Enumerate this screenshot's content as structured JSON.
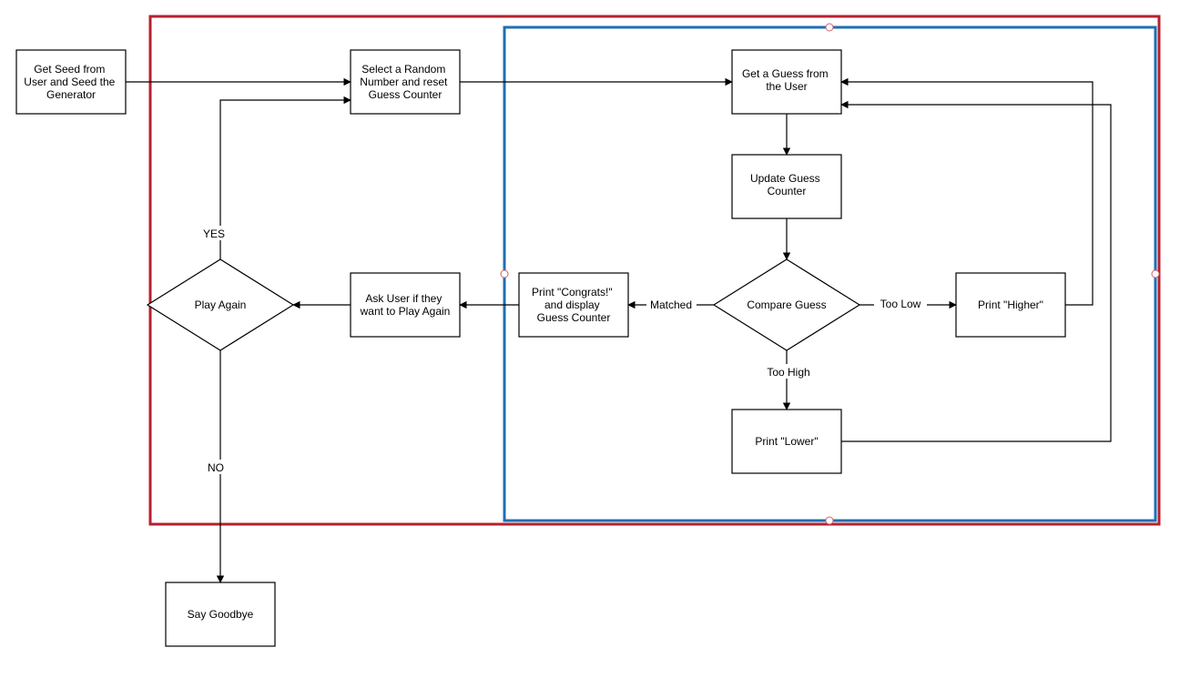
{
  "colors": {
    "outer_container": "#b7202e",
    "inner_container": "#1f6fb2",
    "box_fill": "#ffffff",
    "stroke": "#000000"
  },
  "nodes": {
    "seed": {
      "l1": "Get Seed from",
      "l2": "User and Seed the",
      "l3": "Generator"
    },
    "select": {
      "l1": "Select a Random",
      "l2": "Number and reset",
      "l3": "Guess Counter"
    },
    "get_guess": {
      "l1": "Get a Guess from",
      "l2": "the User"
    },
    "update": {
      "l1": "Update Guess",
      "l2": "Counter"
    },
    "compare": {
      "l1": "Compare Guess"
    },
    "higher": {
      "l1": "Print \"Higher\""
    },
    "lower": {
      "l1": "Print \"Lower\""
    },
    "congrats": {
      "l1": "Print \"Congrats!\"",
      "l2": "and display",
      "l3": "Guess Counter"
    },
    "ask": {
      "l1": "Ask User if they",
      "l2": "want to Play Again"
    },
    "play_again": {
      "l1": "Play Again"
    },
    "goodbye": {
      "l1": "Say Goodbye"
    }
  },
  "edges": {
    "yes": "YES",
    "no": "NO",
    "matched": "Matched",
    "too_high": "Too High",
    "too_low": "Too Low"
  }
}
